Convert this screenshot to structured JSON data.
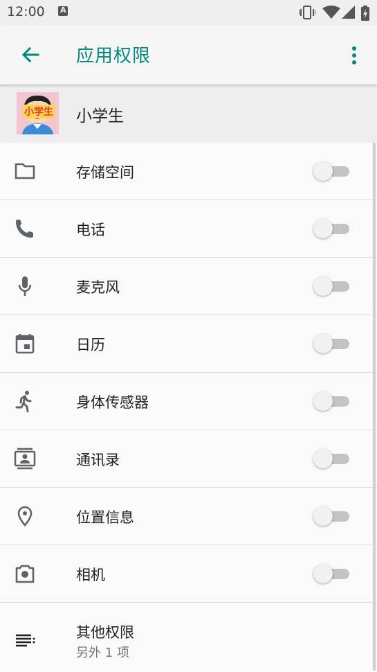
{
  "status_bar": {
    "time": "12:00",
    "notification_letter": "A"
  },
  "app_bar": {
    "title": "应用权限"
  },
  "app_info": {
    "name": "小学生",
    "avatar_text": "小学生"
  },
  "permissions": [
    {
      "label": "存储空间",
      "icon": "folder-icon",
      "enabled": false
    },
    {
      "label": "电话",
      "icon": "phone-icon",
      "enabled": false
    },
    {
      "label": "麦克风",
      "icon": "microphone-icon",
      "enabled": false
    },
    {
      "label": "日历",
      "icon": "calendar-icon",
      "enabled": false
    },
    {
      "label": "身体传感器",
      "icon": "running-person-icon",
      "enabled": false
    },
    {
      "label": "通讯录",
      "icon": "contacts-icon",
      "enabled": false
    },
    {
      "label": "位置信息",
      "icon": "location-pin-icon",
      "enabled": false
    },
    {
      "label": "相机",
      "icon": "camera-icon",
      "enabled": false
    }
  ],
  "other_permissions": {
    "label": "其他权限",
    "sublabel": "另外 1 项",
    "icon": "list-icon"
  },
  "colors": {
    "accent": "#00897b",
    "icon": "#5f6368",
    "toggle_track": "#c3c3c3",
    "toggle_thumb": "#f1f1f1"
  }
}
